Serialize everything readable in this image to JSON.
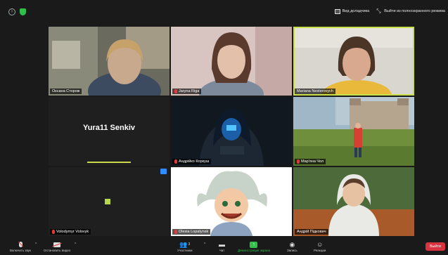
{
  "topbar": {
    "view_label": "Вид доладчика",
    "fullscreen_label": "Выйти из полноэкранного режима"
  },
  "participants": [
    {
      "name": "Оксана Сторож"
    },
    {
      "name": "Jaryna Riga"
    },
    {
      "name": "Mariana Nesterovych"
    },
    {
      "name": "Yura11 Senkiv"
    },
    {
      "name": "Андрійко Коркуш"
    },
    {
      "name": "Мар'яна Чол"
    },
    {
      "name": "Volodymyr Volovyk"
    },
    {
      "name": "Olesia Lopatynsk"
    },
    {
      "name": "Андрій Підкович"
    }
  ],
  "toolbar": {
    "unmute_label": "Включить звук",
    "video_label": "Остановить видео",
    "participants_label": "Участники",
    "participants_count": "3",
    "chat_label": "Чат",
    "share_label": "Демонстрация экрана",
    "record_label": "Запись",
    "reactions_label": "Реакции",
    "leave_label": "Выйти"
  },
  "colors": {
    "active_speaker": "#c9e04a",
    "share_green": "#2fbf4a",
    "leave_red": "#d9333f",
    "muted_red": "#e23a3a"
  }
}
